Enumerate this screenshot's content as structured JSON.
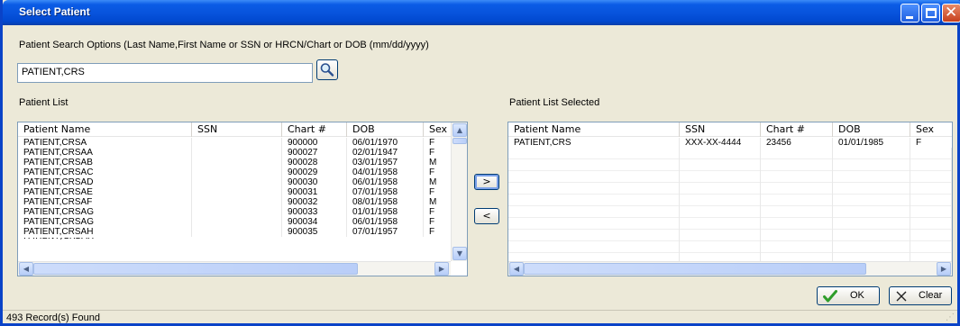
{
  "window": {
    "title": "Select Patient"
  },
  "search": {
    "options_label": "Patient Search Options (Last Name,First Name or SSN or HRCN/Chart or DOB (mm/dd/yyyy)",
    "value": "PATIENT,CRS",
    "button_icon": "magnifier-icon"
  },
  "patient_list": {
    "label": "Patient List",
    "columns": [
      "Patient Name",
      "SSN",
      "Chart #",
      "DOB",
      "Sex"
    ],
    "rows": [
      [
        "PATIENT,CRSA",
        "",
        "900000",
        "06/01/1970",
        "F"
      ],
      [
        "PATIENT,CRSAA",
        "",
        "900027",
        "02/01/1947",
        "F"
      ],
      [
        "PATIENT,CRSAB",
        "",
        "900028",
        "03/01/1957",
        "M"
      ],
      [
        "PATIENT,CRSAC",
        "",
        "900029",
        "04/01/1958",
        "F"
      ],
      [
        "PATIENT,CRSAD",
        "",
        "900030",
        "06/01/1958",
        "M"
      ],
      [
        "PATIENT,CRSAE",
        "",
        "900031",
        "07/01/1958",
        "F"
      ],
      [
        "PATIENT,CRSAF",
        "",
        "900032",
        "08/01/1958",
        "M"
      ],
      [
        "PATIENT,CRSAG",
        "",
        "900033",
        "01/01/1958",
        "F"
      ],
      [
        "PATIENT,CRSAG",
        "",
        "900034",
        "06/01/1958",
        "F"
      ],
      [
        "PATIENT,CRSAH",
        "",
        "900035",
        "07/01/1957",
        "F"
      ]
    ]
  },
  "selected_list": {
    "label": "Patient List Selected",
    "columns": [
      "Patient Name",
      "SSN",
      "Chart #",
      "DOB",
      "Sex"
    ],
    "rows": [
      [
        "PATIENT,CRS",
        "XXX-XX-4444",
        "23456",
        "01/01/1985",
        "F"
      ]
    ]
  },
  "move_buttons": {
    "add_label": ">",
    "remove_label": "<"
  },
  "actions": {
    "ok_label": "OK",
    "clear_label": "Clear",
    "ok_icon": "checkmark-icon",
    "clear_icon": "x-icon"
  },
  "status": {
    "records_found": "493 Record(s) Found"
  },
  "colors": {
    "title_bar": "#0854dd",
    "frame": "#0a43c8",
    "dialog_bg": "#ece9d8",
    "ok_check": "#2e9d2a"
  }
}
